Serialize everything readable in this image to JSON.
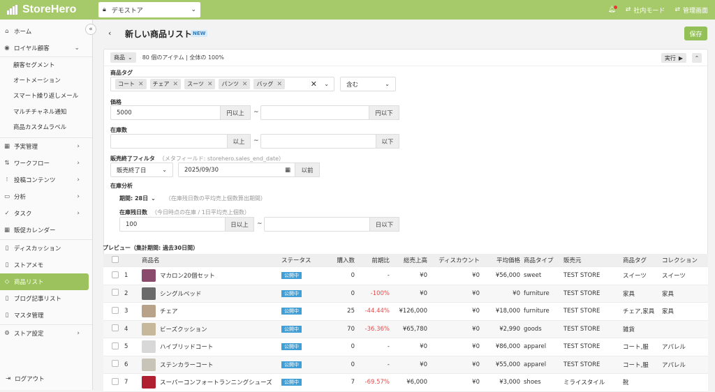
{
  "app": {
    "brand": "StoreHero",
    "store_select": "デモストア",
    "internal_mode": "社内モード",
    "admin": "管理画面"
  },
  "sidebar": {
    "items": [
      {
        "label": "ホーム",
        "icon": "home-icon"
      },
      {
        "label": "ロイヤル顧客",
        "icon": "user-icon",
        "expanded": true
      },
      {
        "label": "予実管理",
        "icon": "calendar-icon"
      },
      {
        "label": "ワークフロー",
        "icon": "workflow-icon"
      },
      {
        "label": "投稿コンテンツ",
        "icon": "content-icon"
      },
      {
        "label": "分析",
        "icon": "chart-icon"
      },
      {
        "label": "タスク",
        "icon": "task-icon"
      },
      {
        "label": "販促カレンダー",
        "icon": "calendar-icon"
      },
      {
        "label": "ディスカッション",
        "icon": "doc-icon"
      },
      {
        "label": "ストアメモ",
        "icon": "doc-icon"
      },
      {
        "label": "商品リスト",
        "icon": "tag-icon",
        "active": true
      },
      {
        "label": "ブログ記事リスト",
        "icon": "doc-icon"
      },
      {
        "label": "マスタ管理",
        "icon": "doc-icon"
      },
      {
        "label": "ストア設定",
        "icon": "gear-icon"
      }
    ],
    "subitems": [
      "顧客セグメント",
      "オートメーション",
      "スマート繰り返しメール",
      "マルチチャネル通知",
      "商品カスタムラベル"
    ],
    "logout": "ログアウト"
  },
  "page": {
    "title": "新しい商品リスト",
    "badge": "NEW",
    "save": "保存"
  },
  "filter": {
    "scope": "商品",
    "count_text": "80 個のアイテム | 全体の 100%",
    "run": "実行",
    "tag_label": "商品タグ",
    "tags": [
      "コート",
      "チェア",
      "スーツ",
      "パンツ",
      "バッグ"
    ],
    "tag_mode": "含む",
    "price_label": "価格",
    "price_min": "5000",
    "price_min_unit": "円以上",
    "price_max_unit": "円以下",
    "stock_label": "在庫数",
    "stock_min_unit": "以上",
    "stock_max_unit": "以下",
    "end_label": "販売終了フィルタ",
    "end_hint": "（メタフィールド: storehero.sales_end_date）",
    "end_field": "販売終了日",
    "end_date": "2025/09/30",
    "end_unit": "以前",
    "analysis_label": "在庫分析",
    "period": "期間: 28日",
    "period_hint": "（在庫残日数の平均売上個数算出期間）",
    "days_label": "在庫残日数",
    "days_hint": "（今日時点の在庫 / 1日平均売上個数）",
    "days_min": "100",
    "days_min_unit": "日以上",
    "days_max_unit": "日以下",
    "tilde": "~"
  },
  "preview_label": "プレビュー（集計期間: 過去30日間）",
  "table": {
    "headers": [
      "商品名",
      "ステータス",
      "購入数",
      "前期比",
      "総売上高",
      "ディスカウント",
      "平均価格",
      "商品タイプ",
      "販売元",
      "商品タグ",
      "コレクション"
    ],
    "rows": [
      {
        "no": "1",
        "name": "マカロン20個セット",
        "status": "公開中",
        "qty": "0",
        "ratio": "-",
        "sales": "¥0",
        "disc": "¥0",
        "avg": "¥56,000",
        "type": "sweet",
        "vendor": "TEST STORE",
        "tags": "スイーツ",
        "coll": "スイーツ",
        "thumb": "#8a4a6b",
        "neg": false
      },
      {
        "no": "2",
        "name": "シングルベッド",
        "status": "公開中",
        "qty": "0",
        "ratio": "-100%",
        "sales": "¥0",
        "disc": "¥0",
        "avg": "¥0",
        "type": "furniture",
        "vendor": "TEST STORE",
        "tags": "家具",
        "coll": "家具",
        "thumb": "#6b6b6b",
        "neg": true
      },
      {
        "no": "3",
        "name": "チェア",
        "status": "公開中",
        "qty": "25",
        "ratio": "-44.44%",
        "sales": "¥126,000",
        "disc": "¥0",
        "avg": "¥18,000",
        "type": "furniture",
        "vendor": "TEST STORE",
        "tags": "チェア,家具",
        "coll": "家具",
        "thumb": "#b8a38a",
        "neg": true
      },
      {
        "no": "4",
        "name": "ビーズクッション",
        "status": "公開中",
        "qty": "70",
        "ratio": "-36.36%",
        "sales": "¥65,780",
        "disc": "¥0",
        "avg": "¥2,990",
        "type": "goods",
        "vendor": "TEST STORE",
        "tags": "雑貨",
        "coll": "",
        "thumb": "#c7b89b",
        "neg": true
      },
      {
        "no": "5",
        "name": "ハイブリッドコート",
        "status": "公開中",
        "qty": "0",
        "ratio": "-",
        "sales": "¥0",
        "disc": "¥0",
        "avg": "¥86,000",
        "type": "apparel",
        "vendor": "TEST STORE",
        "tags": "コート,服",
        "coll": "アパレル",
        "thumb": "#d8d8d8",
        "neg": false
      },
      {
        "no": "6",
        "name": "ステンカラーコート",
        "status": "公開中",
        "qty": "0",
        "ratio": "-",
        "sales": "¥0",
        "disc": "¥0",
        "avg": "¥55,000",
        "type": "apparel",
        "vendor": "TEST STORE",
        "tags": "コート,服",
        "coll": "アパレル",
        "thumb": "#c9c4b8",
        "neg": false
      },
      {
        "no": "7",
        "name": "スーパーコンフォートランニングシューズ",
        "status": "公開中",
        "qty": "7",
        "ratio": "-69.57%",
        "sales": "¥6,000",
        "disc": "¥0",
        "avg": "¥3,000",
        "type": "shoes",
        "vendor": "ミライスタイル",
        "tags": "靴",
        "coll": "",
        "thumb": "#b02030",
        "neg": true
      }
    ]
  },
  "colors": {
    "brand": "#a6c96a",
    "active": "#9cc25e",
    "status": "#3f9fd6",
    "negative": "#e04c4c"
  }
}
